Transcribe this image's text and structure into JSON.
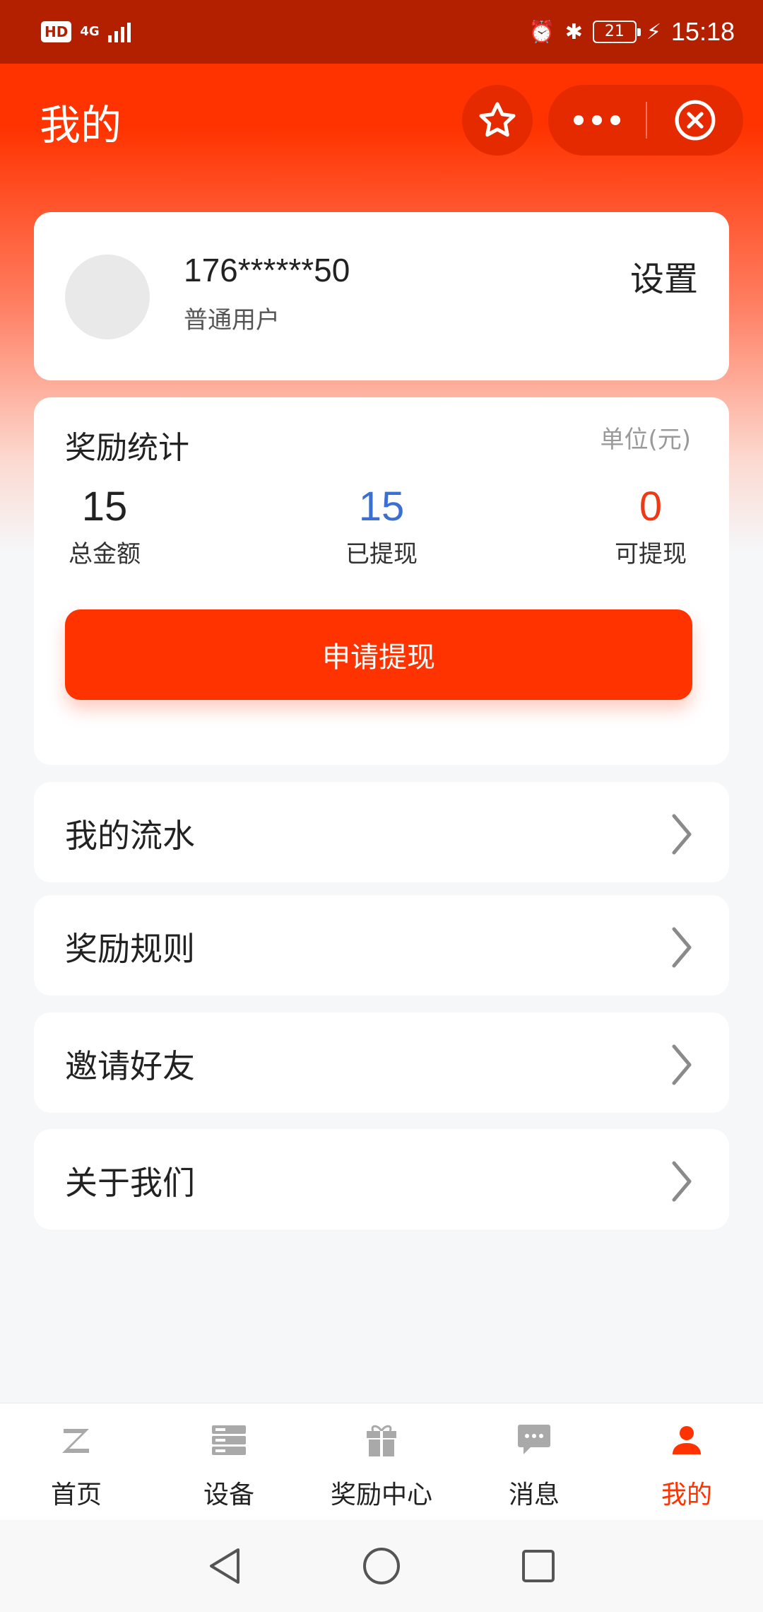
{
  "status_bar": {
    "hd": "HD",
    "network": "4G",
    "battery": "21",
    "time": "15:18"
  },
  "header": {
    "title": "我的"
  },
  "profile": {
    "phone": "176******50",
    "user_type": "普通用户",
    "settings_label": "设置"
  },
  "stats": {
    "title": "奖励统计",
    "unit": "单位(元)",
    "total": {
      "value": "15",
      "label": "总金额"
    },
    "withdrawn": {
      "value": "15",
      "label": "已提现"
    },
    "available": {
      "value": "0",
      "label": "可提现"
    },
    "apply_button": "申请提现"
  },
  "menu": [
    {
      "label": "我的流水"
    },
    {
      "label": "奖励规则"
    },
    {
      "label": "邀请好友"
    },
    {
      "label": "关于我们"
    }
  ],
  "tabbar": {
    "active_color": "#ff3300",
    "items": [
      {
        "label": "首页",
        "icon": "z-logo-icon"
      },
      {
        "label": "设备",
        "icon": "server-icon"
      },
      {
        "label": "奖励中心",
        "icon": "gift-icon"
      },
      {
        "label": "消息",
        "icon": "chat-icon"
      },
      {
        "label": "我的",
        "icon": "person-icon"
      }
    ]
  },
  "theme": {
    "primary": "#ff3300",
    "status_bar": "#b32000",
    "blue_value": "#3b6fd1"
  }
}
